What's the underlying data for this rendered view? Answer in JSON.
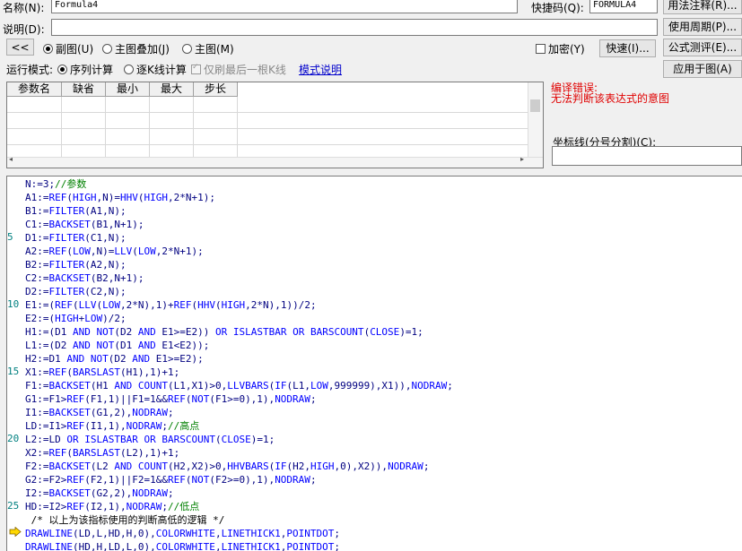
{
  "top": {
    "name_label": "名称(N):",
    "name_value": "Formula4",
    "shortcut_label": "快捷码(Q):",
    "shortcut_value": "FORMULA4",
    "desc_label": "说明(D):",
    "desc_value": ""
  },
  "right_buttons": [
    "用法注释(R)...",
    "使用周期(P)...",
    "公式测评(E)...",
    "应用于图(A)"
  ],
  "row3": {
    "collapse_btn": "<<",
    "radio_sub": "副图(U)",
    "radio_overlay": "主图叠加(J)",
    "radio_main": "主图(M)",
    "encrypt": "加密(Y)",
    "quick_btn": "快速(I)..."
  },
  "run_mode": {
    "label": "运行模式:",
    "seq": "序列计算",
    "line": "逐K线计算",
    "last_only": "仅刷最后一根K线",
    "link": "模式说明"
  },
  "param_table": {
    "headers": [
      "参数名",
      "缺省",
      "最小",
      "最大",
      "步长"
    ]
  },
  "compile": {
    "title": "编译错误:",
    "message": "无法判断该表达式的意图"
  },
  "axis_label": "坐标线(分号分割)(C):",
  "colors": {
    "error": "#e00000",
    "keyword": "#0000ff",
    "comment": "#008000",
    "lineno": "#008080",
    "arrow": "#ffd800"
  },
  "code": [
    {
      "n": "",
      "t": "N:=3;//参数"
    },
    {
      "n": "",
      "t": "A1:=REF(HIGH,N)=HHV(HIGH,2*N+1);"
    },
    {
      "n": "",
      "t": "B1:=FILTER(A1,N);"
    },
    {
      "n": "",
      "t": "C1:=BACKSET(B1,N+1);"
    },
    {
      "n": "5",
      "t": "D1:=FILTER(C1,N);"
    },
    {
      "n": "",
      "t": "A2:=REF(LOW,N)=LLV(LOW,2*N+1);"
    },
    {
      "n": "",
      "t": "B2:=FILTER(A2,N);"
    },
    {
      "n": "",
      "t": "C2:=BACKSET(B2,N+1);"
    },
    {
      "n": "",
      "t": "D2:=FILTER(C2,N);"
    },
    {
      "n": "10",
      "t": "E1:=(REF(LLV(LOW,2*N),1)+REF(HHV(HIGH,2*N),1))/2;"
    },
    {
      "n": "",
      "t": "E2:=(HIGH+LOW)/2;"
    },
    {
      "n": "",
      "t": "H1:=(D1 AND NOT(D2 AND E1>=E2)) OR ISLASTBAR OR BARSCOUNT(CLOSE)=1;"
    },
    {
      "n": "",
      "t": "L1:=(D2 AND NOT(D1 AND E1<E2));"
    },
    {
      "n": "",
      "t": "H2:=D1 AND NOT(D2 AND E1>=E2);"
    },
    {
      "n": "15",
      "t": "X1:=REF(BARSLAST(H1),1)+1;"
    },
    {
      "n": "",
      "t": "F1:=BACKSET(H1 AND COUNT(L1,X1)>0,LLVBARS(IF(L1,LOW,999999),X1)),NODRAW;"
    },
    {
      "n": "",
      "t": "G1:=F1>REF(F1,1)||F1=1&&REF(NOT(F1>=0),1),NODRAW;"
    },
    {
      "n": "",
      "t": "I1:=BACKSET(G1,2),NODRAW;"
    },
    {
      "n": "",
      "t": "LD:=I1>REF(I1,1),NODRAW;//高点"
    },
    {
      "n": "20",
      "t": "L2:=LD OR ISLASTBAR OR BARSCOUNT(CLOSE)=1;"
    },
    {
      "n": "",
      "t": "X2:=REF(BARSLAST(L2),1)+1;"
    },
    {
      "n": "",
      "t": "F2:=BACKSET(L2 AND COUNT(H2,X2)>0,HHVBARS(IF(H2,HIGH,0),X2)),NODRAW;"
    },
    {
      "n": "",
      "t": "G2:=F2>REF(F2,1)||F2=1&&REF(NOT(F2>=0),1),NODRAW;"
    },
    {
      "n": "",
      "t": "I2:=BACKSET(G2,2),NODRAW;"
    },
    {
      "n": "25",
      "t": "HD:=I2>REF(I2,1),NODRAW;//低点"
    },
    {
      "n": "",
      "t": " /* 以上为该指标使用的判断高低的逻辑 */"
    },
    {
      "n": "",
      "t": "DRAWLINE(LD,L,HD,H,0),COLORWHITE,LINETHICK1,POINTDOT;"
    },
    {
      "n": "",
      "t": "DRAWLINE(HD,H,LD,L,0),COLORWHITE,LINETHICK1,POINTDOT;"
    }
  ]
}
